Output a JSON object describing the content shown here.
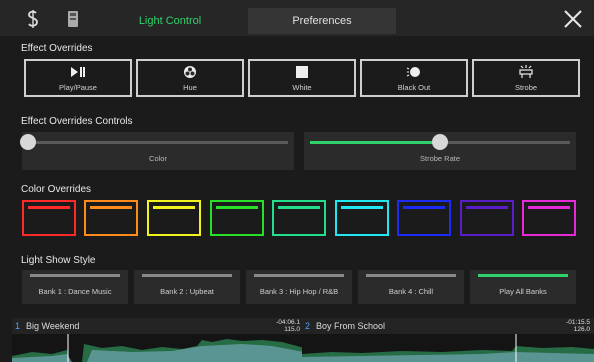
{
  "tabs": {
    "light_control": "Light Control",
    "preferences": "Preferences"
  },
  "effect_overrides": {
    "title": "Effect Overrides",
    "buttons": [
      {
        "label": "Play/Pause",
        "icon": "play-pause-icon"
      },
      {
        "label": "Hue",
        "icon": "hue-icon"
      },
      {
        "label": "White",
        "icon": "white-icon"
      },
      {
        "label": "Black Out",
        "icon": "blackout-icon"
      },
      {
        "label": "Strobe",
        "icon": "strobe-icon"
      }
    ]
  },
  "effect_controls": {
    "title": "Effect Overrides Controls",
    "color": {
      "label": "Color",
      "value": 0.0
    },
    "strobe": {
      "label": "Strobe Rate",
      "value": 0.5
    }
  },
  "color_overrides": {
    "title": "Color Overrides",
    "colors": [
      "#ff2a2a",
      "#ff8c1a",
      "#f2f21e",
      "#27e027",
      "#22e08a",
      "#22e6f0",
      "#1e2bf5",
      "#5a1ec8",
      "#e62ad8"
    ]
  },
  "light_show": {
    "title": "Light Show Style",
    "banks": [
      {
        "label": "Bank 1 : Dance Music",
        "active": false
      },
      {
        "label": "Bank 2 : Upbeat",
        "active": false
      },
      {
        "label": "Bank 3 : Hip Hop / R&B",
        "active": false
      },
      {
        "label": "Bank 4 : Chill",
        "active": false
      },
      {
        "label": "Play All Banks",
        "active": true
      }
    ]
  },
  "decks": [
    {
      "number": "1",
      "title": "Big Weekend",
      "time": "-04:06.1",
      "bpm": "115.0"
    },
    {
      "number": "2",
      "title": "Boy From School",
      "time": "-01:15.5",
      "bpm": "126.0"
    }
  ],
  "colors": {
    "accent": "#2fd16b",
    "deck_number": "#4aa3ff"
  }
}
